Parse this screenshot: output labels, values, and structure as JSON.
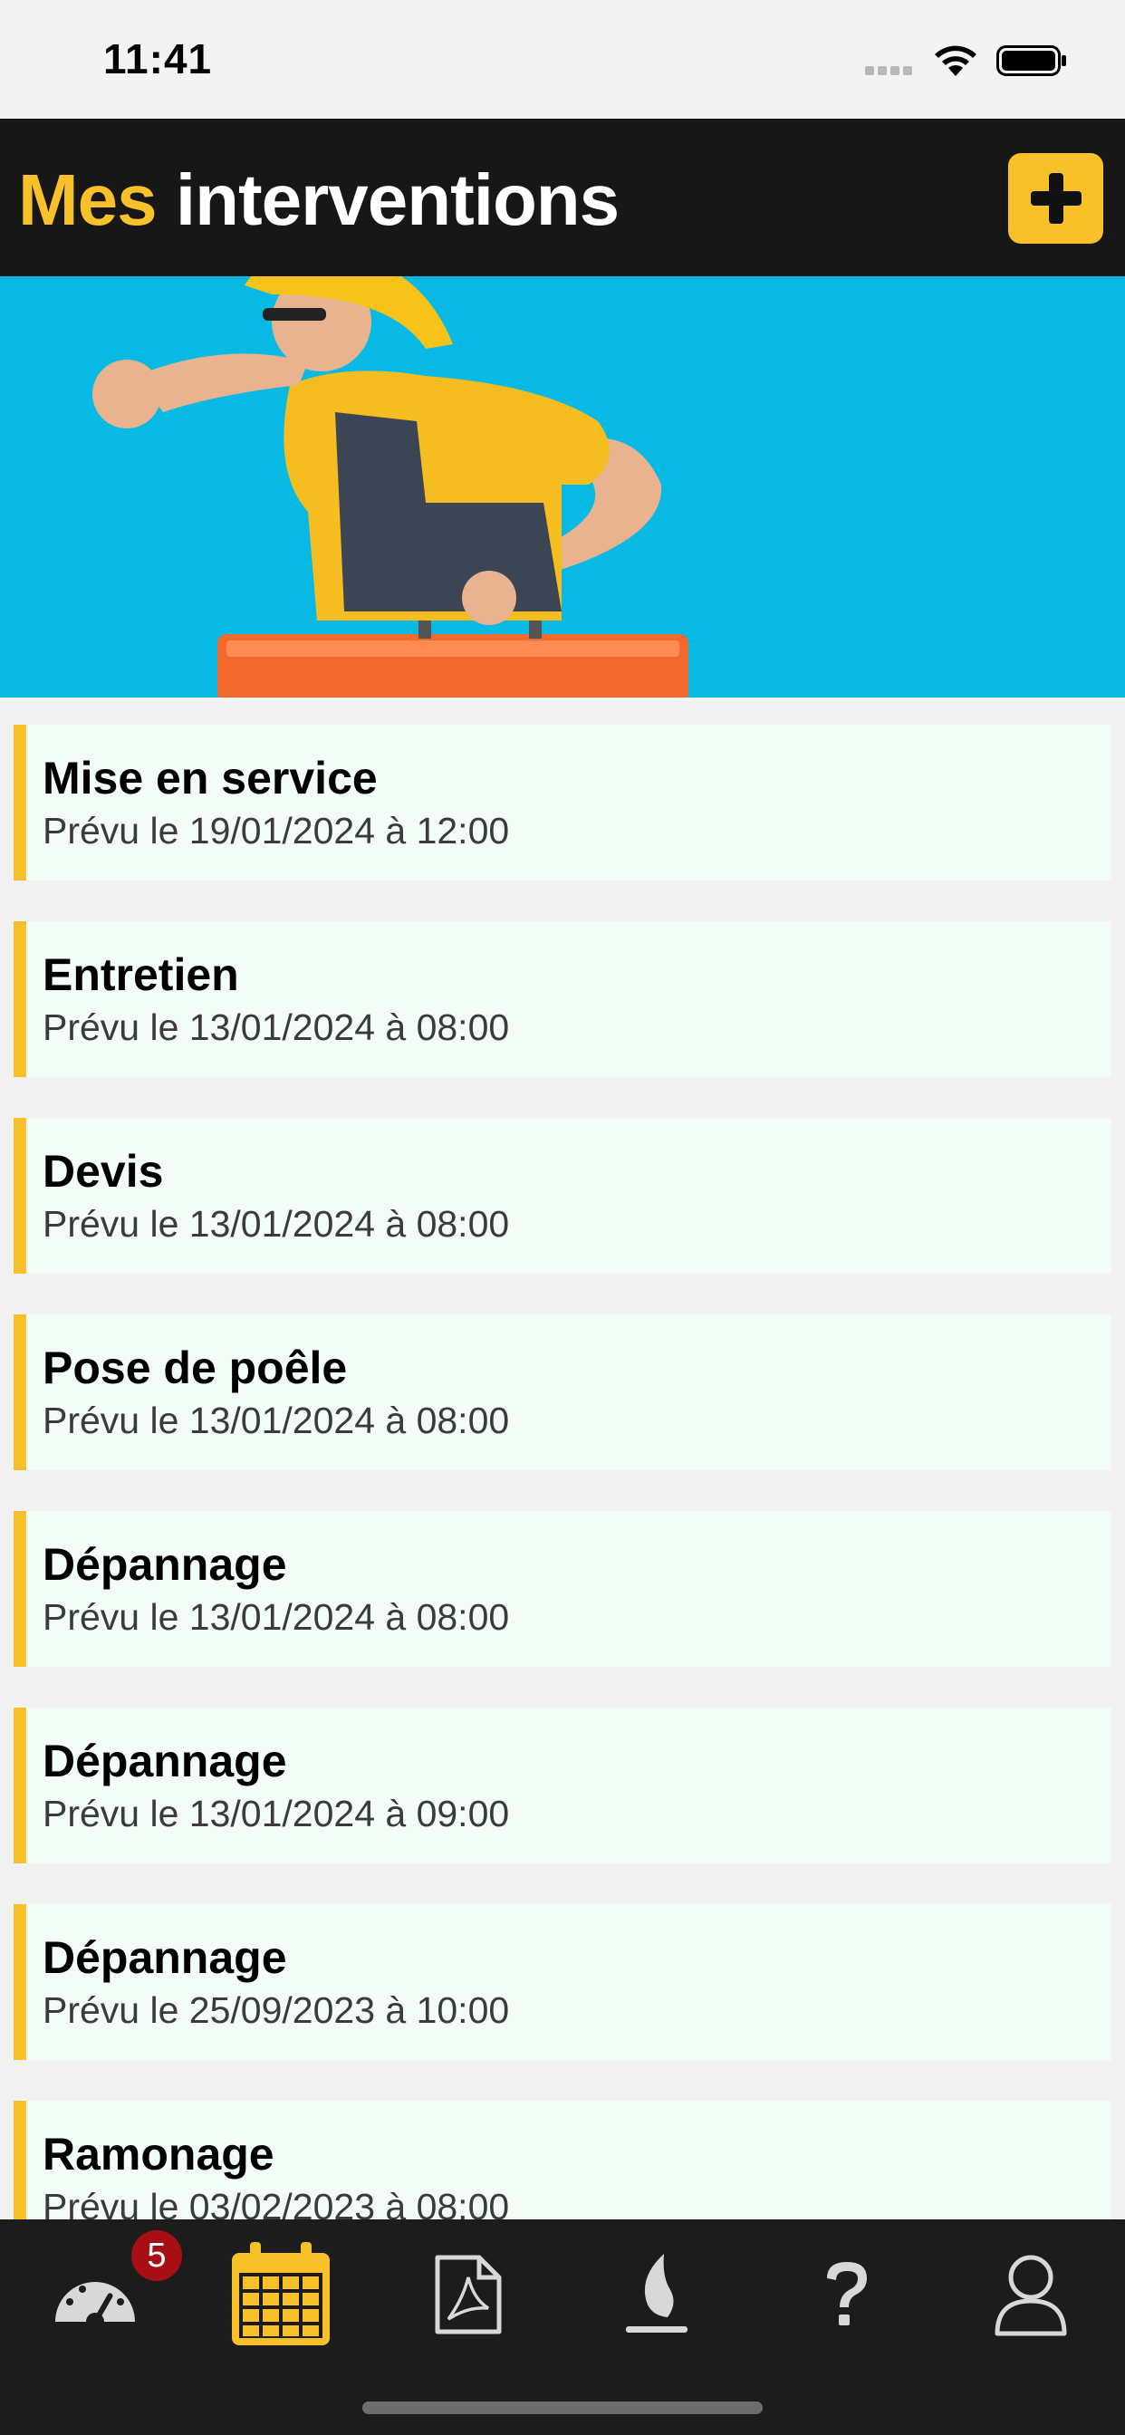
{
  "status_bar": {
    "time": "11:41"
  },
  "header": {
    "title_accent": "Mes",
    "title_rest": "interventions"
  },
  "banner": {
    "image": "worker-with-toolbox-photo"
  },
  "interventions": [
    {
      "title": "Mise en service",
      "date": "Prévu le 19/01/2024 à 12:00"
    },
    {
      "title": "Entretien",
      "date": "Prévu le 13/01/2024 à 08:00"
    },
    {
      "title": "Devis",
      "date": "Prévu le 13/01/2024 à 08:00"
    },
    {
      "title": "Pose de poêle",
      "date": "Prévu le 13/01/2024 à 08:00"
    },
    {
      "title": "Dépannage",
      "date": "Prévu le 13/01/2024 à 08:00"
    },
    {
      "title": "Dépannage",
      "date": "Prévu le 13/01/2024 à 09:00"
    },
    {
      "title": "Dépannage",
      "date": "Prévu le 25/09/2023 à 10:00"
    },
    {
      "title": "Ramonage",
      "date": "Prévu le 03/02/2023 à 08:00"
    }
  ],
  "tab_bar": {
    "dashboard_badge": "5",
    "tabs": [
      "dashboard-icon",
      "calendar-icon",
      "pdf-icon",
      "flame-icon",
      "help-icon",
      "profile-icon"
    ],
    "active_tab": "calendar-icon"
  },
  "colors": {
    "accent": "#f8c12a",
    "header_bg": "#171717",
    "item_bg": "#f3fdf8",
    "badge": "#a80f14"
  }
}
